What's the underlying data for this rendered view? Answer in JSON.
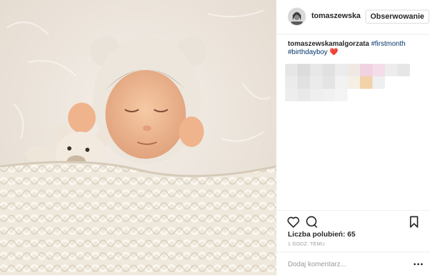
{
  "header": {
    "username": "tomaszewska",
    "follow_label": "Obserwowanie",
    "avatar_icon": "profile-avatar"
  },
  "caption": {
    "username": "tomaszewskamalgorzata",
    "hashtags": [
      "#firstmonth",
      "#birthdayboy"
    ],
    "emoji": "❤️"
  },
  "actions": {
    "like_icon": "heart-outline-icon",
    "comment_icon": "comment-bubble-icon",
    "save_icon": "bookmark-icon"
  },
  "likes_text": "Liczba polubień: 65",
  "timestamp": "1 GODZ. TEMU",
  "comment": {
    "placeholder": "Dodaj komentarz...",
    "more_icon": "ellipsis-icon"
  },
  "colors": {
    "hashtag": "#003569",
    "heart": "#e0245e",
    "border": "#efefef"
  }
}
